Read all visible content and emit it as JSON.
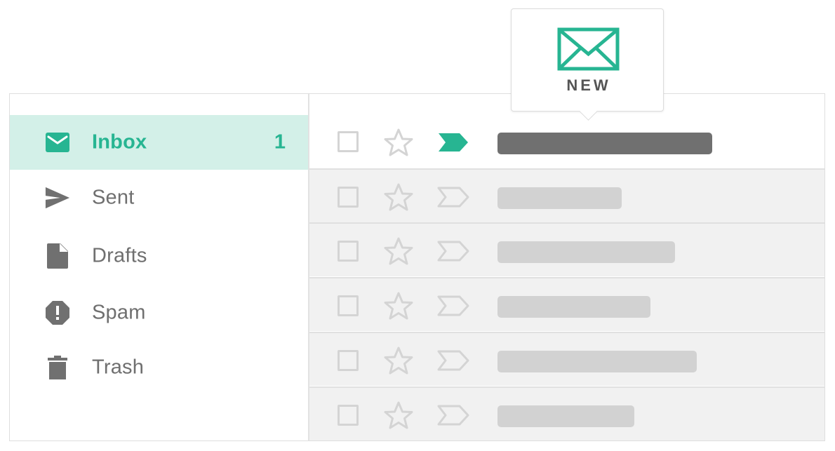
{
  "sidebar": {
    "items": [
      {
        "label": "Inbox",
        "count": "1",
        "icon": "envelope-icon",
        "active": true
      },
      {
        "label": "Sent",
        "icon": "send-icon"
      },
      {
        "label": "Drafts",
        "icon": "draft-file-icon"
      },
      {
        "label": "Spam",
        "icon": "spam-octagon-icon"
      },
      {
        "label": "Trash",
        "icon": "trash-icon"
      }
    ]
  },
  "new_badge": {
    "label": "NEW",
    "icon": "envelope-outline-icon"
  },
  "colors": {
    "accent": "#27b592",
    "active_bg": "#d3f0e8",
    "muted_text": "#6f6f6f",
    "placeholder": "#d2d2d2",
    "placeholder_dark": "#707070"
  }
}
